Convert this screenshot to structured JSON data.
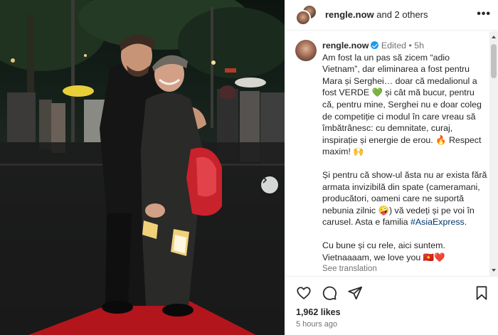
{
  "header": {
    "username": "rengle.now",
    "others": " and 2 others",
    "more_icon": "more-horizontal-icon"
  },
  "caption": {
    "username": "rengle.now",
    "edited": "Edited",
    "separator": "•",
    "time": "5h",
    "p1": "Am fost la un pas să zicem “adio Vietnam”, dar eliminarea a fost pentru Mara și Serghei… doar că medalionul a fost VERDE 💚 și cât mă bucur, pentru că, pentru mine, Serghei nu e doar coleg de competiție ci modul în care vreau să îmbătrânesc: cu demnitate, curaj, inspirație și energie de erou. 🔥 Respect maxim! 🙌",
    "p2_before": "Și pentru că show-ul ăsta nu ar exista fără armata invizibilă din spate (cameramani, producători, oameni care ne suportă nebunia zilnic 🤪) vă vedeți și pe voi în carusel. Asta e familia",
    "hashtag": "#AsiaExpress",
    "p2_after": ".",
    "p3": "Cu bune și cu rele, aici suntem. Vietnaaaam, we love you 🇻🇳❤️",
    "see_translation": "See translation"
  },
  "actions": {
    "like_icon": "heart-icon",
    "comment_icon": "comment-icon",
    "share_icon": "share-icon",
    "save_icon": "bookmark-icon"
  },
  "likes": "1,962 likes",
  "posted": "5 hours ago",
  "colors": {
    "verified": "#1d9bf0",
    "hashtag": "#00376b",
    "muted": "#737373",
    "carpet": "#b3151c"
  }
}
